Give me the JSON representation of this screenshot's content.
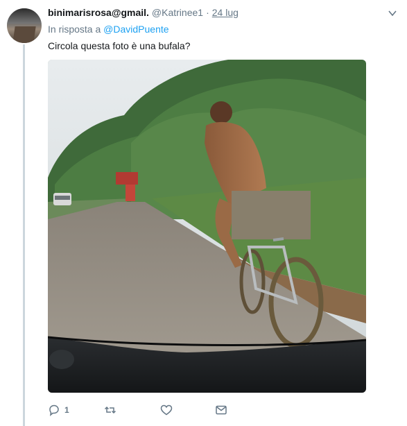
{
  "tweet": {
    "display_name": "binimarisrosa@gmail.",
    "handle": "@Katrinee1",
    "separator": "·",
    "date": "24 lug",
    "reply_prefix": "In risposta a",
    "reply_mention": "@DavidPuente",
    "text": "Circola questa foto è una bufala?",
    "reply_count": "1"
  },
  "icons": {
    "reply": "reply-icon",
    "retweet": "retweet-icon",
    "like": "heart-icon",
    "dm": "envelope-icon",
    "more": "chevron-down-icon"
  },
  "colors": {
    "link": "#1da1f2",
    "secondary_text": "#657786",
    "thread_line": "#ccd6dd"
  }
}
